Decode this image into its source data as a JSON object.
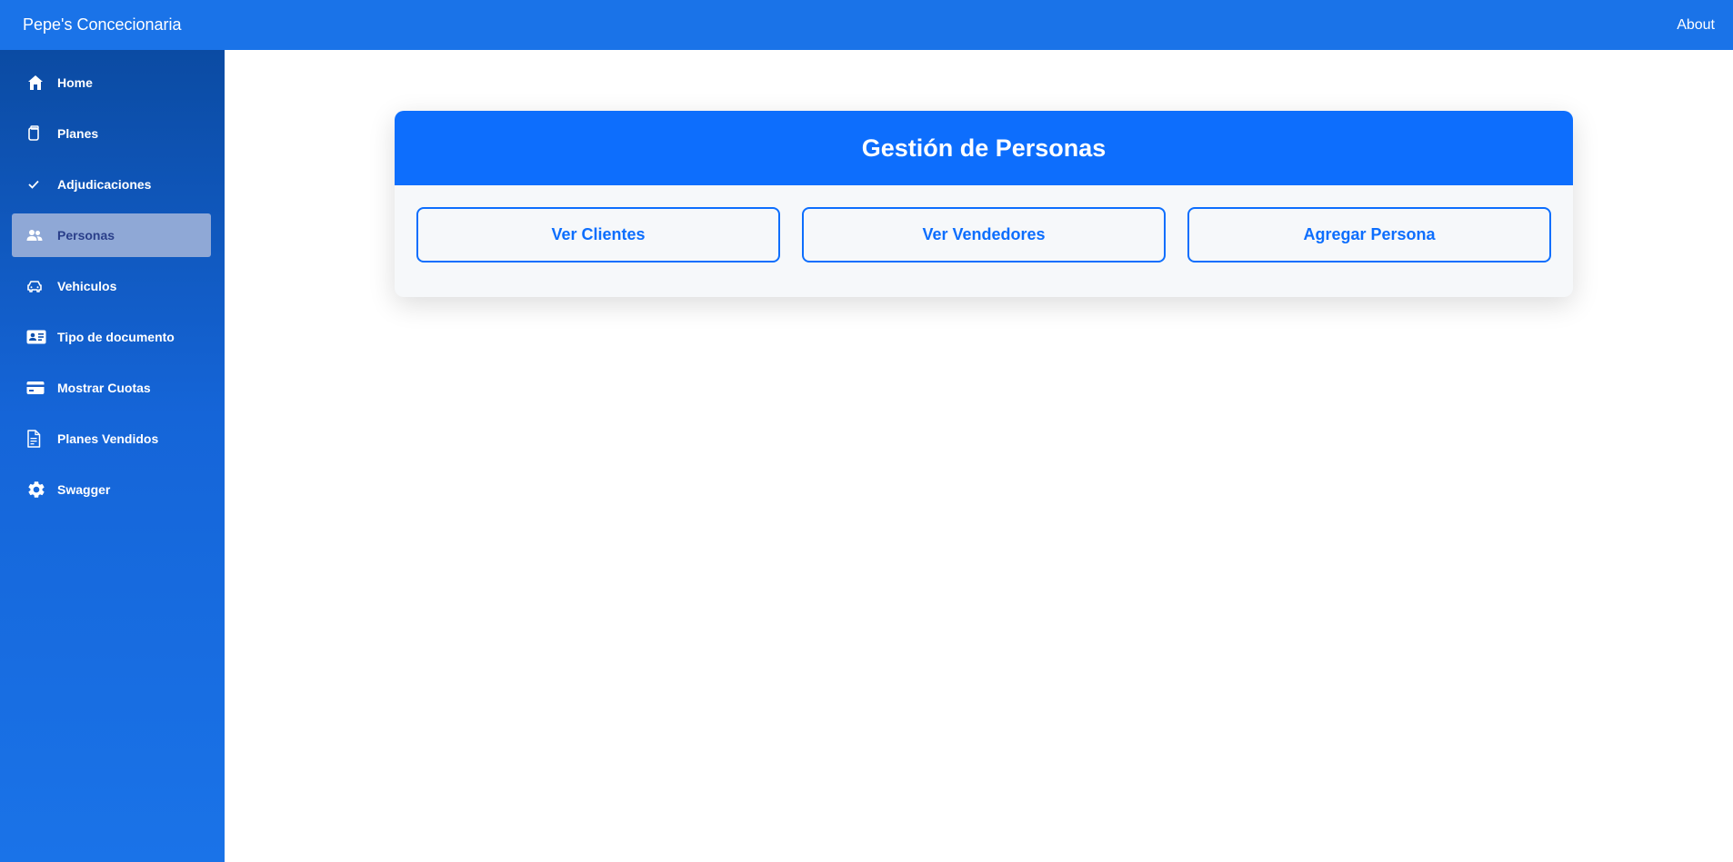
{
  "topbar": {
    "brand": "Pepe's Concecionaria",
    "about_label": "About",
    "background": "#1a73e8"
  },
  "sidebar": {
    "items": [
      {
        "label": "Home",
        "icon": "home-icon",
        "active": false
      },
      {
        "label": "Planes",
        "icon": "clipboard-icon",
        "active": false
      },
      {
        "label": "Adjudicaciones",
        "icon": "check-icon",
        "active": false
      },
      {
        "label": "Personas",
        "icon": "people-icon",
        "active": true
      },
      {
        "label": "Vehiculos",
        "icon": "car-icon",
        "active": false
      },
      {
        "label": "Tipo de documento",
        "icon": "id-card-icon",
        "active": false
      },
      {
        "label": "Mostrar Cuotas",
        "icon": "credit-card-icon",
        "active": false
      },
      {
        "label": "Planes Vendidos",
        "icon": "document-icon",
        "active": false
      },
      {
        "label": "Swagger",
        "icon": "gear-icon",
        "active": false
      }
    ]
  },
  "main": {
    "card_title": "Gestión de Personas",
    "buttons": [
      {
        "label": "Ver Clientes"
      },
      {
        "label": "Ver Vendedores"
      },
      {
        "label": "Agregar Persona"
      }
    ]
  },
  "colors": {
    "accent": "#0d6efd",
    "active_item_bg": "#8fa8d6",
    "card_bg": "#f6f8fa"
  }
}
